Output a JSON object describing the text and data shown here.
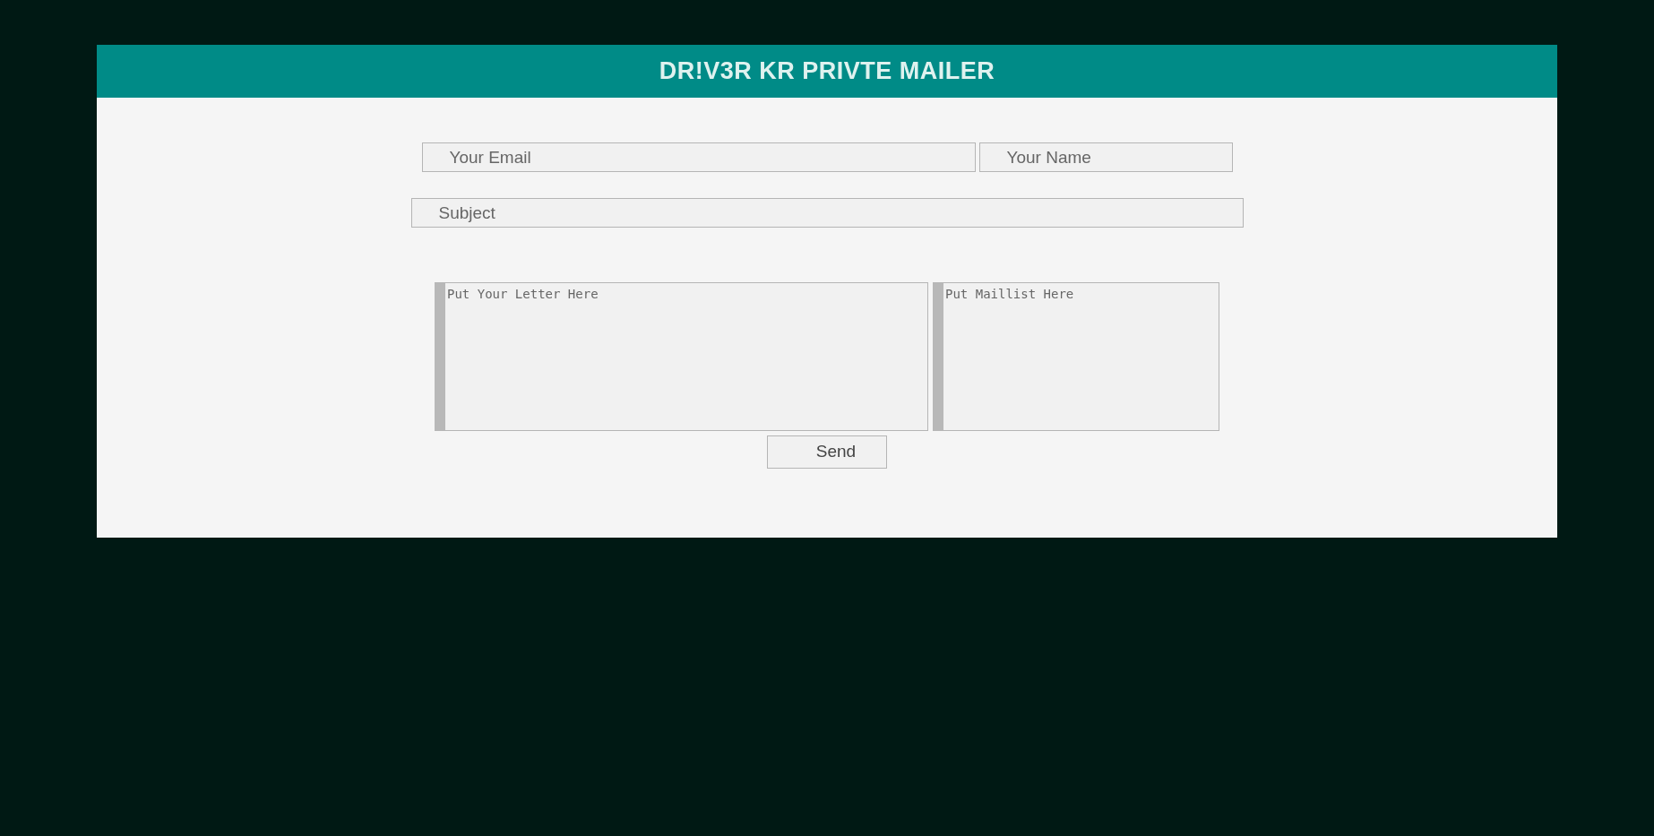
{
  "header": {
    "title": "DR!V3R KR PRIVTE MAILER"
  },
  "fields": {
    "email": {
      "placeholder": "Your Email"
    },
    "name": {
      "placeholder": "Your Name"
    },
    "subject": {
      "placeholder": "Subject"
    }
  },
  "letter": {
    "placeholder": "Put Your Letter Here"
  },
  "maillist": {
    "placeholder": "Put Maillist Here"
  },
  "send_button": {
    "label": "Send"
  }
}
